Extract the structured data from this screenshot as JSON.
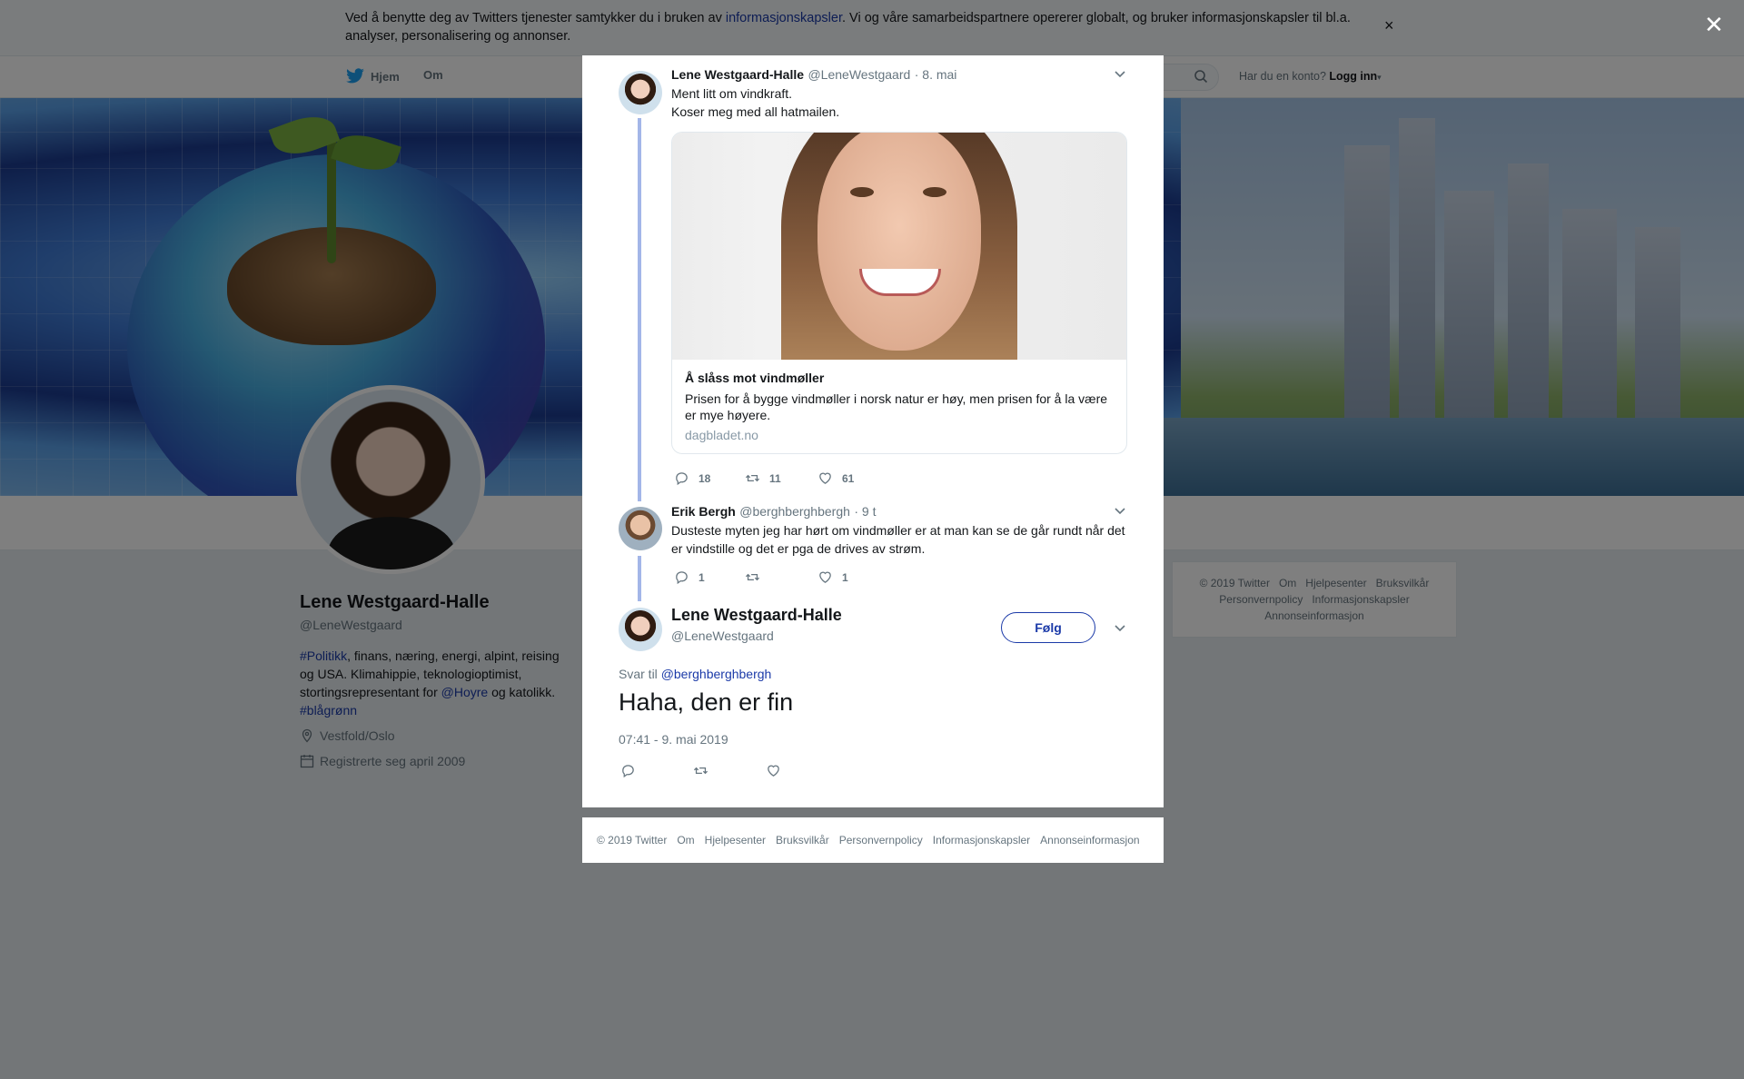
{
  "consent": {
    "text_before": "Ved å benytte deg av Twitters tjenester samtykker du i bruken av ",
    "link": "informasjonskapsler",
    "text_after": ". Vi og våre samarbeidspartnere opererer globalt, og bruker informasjonskapsler til bl.a. analyser, personalisering og annonser.",
    "close": "×"
  },
  "nav": {
    "home": "Hjem",
    "about": "Om",
    "login_prompt": "Har du en konto?",
    "login": "Logg inn"
  },
  "profile": {
    "name": "Lene Westgaard-Halle",
    "handle": "@LeneWestgaard",
    "bio_hashtag1": "#Politikk",
    "bio_text1": ", finans, næring, energi, alpint, reising og USA. Klimahippie, teknologioptimist, stortingsrepresentant for ",
    "bio_mention": "@Hoyre",
    "bio_text2": " og katolikk. ",
    "bio_hashtag2": "#blågrønn",
    "location": "Vestfold/Oslo",
    "joined": "Registrerte seg april 2009"
  },
  "side_footer": [
    "© 2019 Twitter",
    "Om",
    "Hjelpesenter",
    "Bruksvilkår",
    "Personvernpolicy",
    "Informasjonskapsler",
    "Annonseinformasjon"
  ],
  "overlay_close": "✕",
  "tweet1": {
    "name": "Lene Westgaard-Halle",
    "handle": "@LeneWestgaard",
    "time": "· 8. mai",
    "line1": "Ment litt om vindkraft.",
    "line2": "Koser meg med all hatmailen.",
    "card_title": "Å slåss mot vindmøller",
    "card_desc": "Prisen for å bygge vindmøller i norsk natur er høy, men prisen for å la være er mye høyere.",
    "card_domain": "dagbladet.no",
    "replies": "18",
    "retweets": "11",
    "likes": "61"
  },
  "tweet2": {
    "name": "Erik Bergh",
    "handle": "@berghberghbergh",
    "time": "· 9 t",
    "text": "Dusteste myten jeg har hørt om vindmøller er at man kan se de går rundt når det er vindstille og det er pga de drives av strøm.",
    "replies": "1",
    "retweets": "",
    "likes": "1"
  },
  "main_tweet": {
    "name": "Lene Westgaard-Halle",
    "handle": "@LeneWestgaard",
    "follow": "Følg",
    "reply_prefix": "Svar til ",
    "reply_handle": "@berghberghbergh",
    "text": "Haha, den er fin",
    "timestamp": "07:41 - 9. mai 2019"
  },
  "modal_footer": [
    "© 2019 Twitter",
    "Om",
    "Hjelpesenter",
    "Bruksvilkår",
    "Personvernpolicy",
    "Informasjonskapsler",
    "Annonseinformasjon"
  ],
  "colors": {
    "link": "#1b3aa8",
    "muted": "#66757f",
    "thread_line": "#a3b6e8",
    "overlay": "rgba(0,0,0,0.5)"
  },
  "icons": [
    "twitter-bird-icon",
    "search-icon",
    "caret-down-icon",
    "location-pin-icon",
    "calendar-icon",
    "close-icon",
    "chevron-down-icon",
    "reply-icon",
    "retweet-icon",
    "heart-icon"
  ]
}
